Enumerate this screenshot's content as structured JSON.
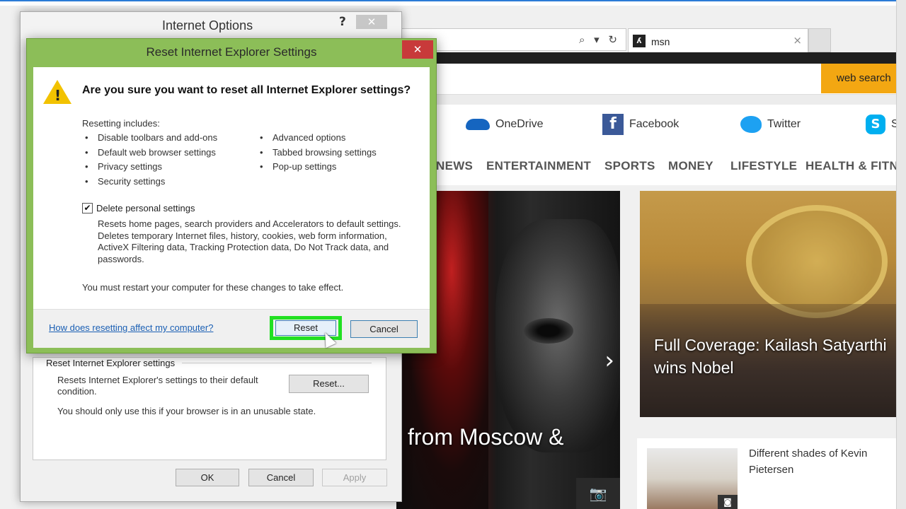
{
  "browser": {
    "tab_title": "msn",
    "tab_close": "×",
    "address_icons": "⌕ ▾ ↻",
    "search_button": "web search"
  },
  "msn": {
    "social": [
      {
        "label": "OneDrive"
      },
      {
        "label": "Facebook"
      },
      {
        "label": "Twitter"
      },
      {
        "label": "S"
      }
    ],
    "nav": [
      "NEWS",
      "ENTERTAINMENT",
      "SPORTS",
      "MONEY",
      "LIFESTYLE",
      "HEALTH & FITNE"
    ],
    "hero_caption": "l from Moscow &",
    "hero_arrow": "›",
    "story_caption": "Full Coverage: Kailash Satyarthi wins Nobel",
    "story2_title": "Different shades of Kevin Pietersen"
  },
  "internet_options": {
    "title": "Internet Options",
    "help": "?",
    "close": "✕",
    "group_title": "Reset Internet Explorer settings",
    "description": "Resets Internet Explorer's settings to their default condition.",
    "warning": "You should only use this if your browser is in an unusable state.",
    "reset_button": "Reset...",
    "ok": "OK",
    "cancel": "Cancel",
    "apply": "Apply"
  },
  "reset_dialog": {
    "title": "Reset Internet Explorer Settings",
    "close": "✕",
    "heading": "Are you sure you want to reset all Internet Explorer settings?",
    "includes_label": "Resetting includes:",
    "includes_left": [
      "Disable toolbars and add-ons",
      "Default web browser settings",
      "Privacy settings",
      "Security settings"
    ],
    "includes_right": [
      "Advanced options",
      "Tabbed browsing settings",
      "Pop-up settings"
    ],
    "delete_personal_label": "Delete personal settings",
    "delete_personal_checked": true,
    "delete_personal_desc": "Resets home pages, search providers and Accelerators to default settings. Deletes temporary Internet files, history, cookies, web form information, ActiveX Filtering data, Tracking Protection data, Do Not Track data, and passwords.",
    "restart_note": "You must restart your computer for these changes to take effect.",
    "help_link": "How does resetting affect my computer?",
    "reset_button": "Reset",
    "cancel_button": "Cancel"
  },
  "colors": {
    "dialog_frame": "#8cbe58",
    "highlight": "#22e022",
    "close_red": "#c83a3a",
    "search_orange": "#f3a712"
  }
}
